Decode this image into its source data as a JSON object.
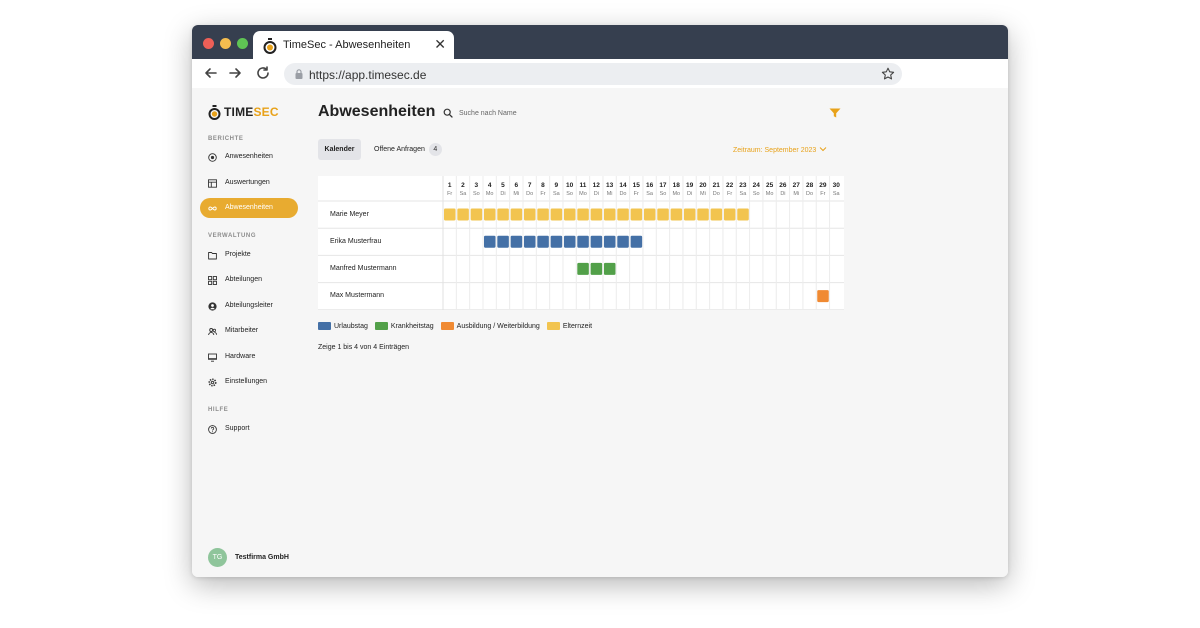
{
  "browser": {
    "tab_title": "TimeSec - Abwesenheiten",
    "url": "https://app.timesec.de",
    "close_symbol": "✕"
  },
  "logo": {
    "part1": "TIME",
    "part2": "SEC"
  },
  "sidebar": {
    "section_berichte": "BERICHTE",
    "section_verwaltung": "VERWALTUNG",
    "section_hilfe": "HILFE",
    "items": [
      {
        "label": "Anwesenheiten",
        "icon": "radio-icon"
      },
      {
        "label": "Auswertungen",
        "icon": "table-icon"
      },
      {
        "label": "Abwesenheiten",
        "icon": "infinity-icon",
        "active": true
      },
      {
        "label": "Projekte",
        "icon": "folder-icon"
      },
      {
        "label": "Abteilungen",
        "icon": "grid-icon"
      },
      {
        "label": "Abteilungsleiter",
        "icon": "user-circle-icon"
      },
      {
        "label": "Mitarbeiter",
        "icon": "users-icon"
      },
      {
        "label": "Hardware",
        "icon": "monitor-icon"
      },
      {
        "label": "Einstellungen",
        "icon": "gear-icon"
      },
      {
        "label": "Support",
        "icon": "help-icon"
      }
    ]
  },
  "company": {
    "initials": "TG",
    "name": "Testfirma GmbH"
  },
  "main": {
    "title": "Abwesenheiten",
    "search_placeholder": "Suche nach Name",
    "tab_kalender": "Kalender",
    "tab_anfragen": "Offene Anfragen",
    "anfragen_count": "4",
    "zeitraum": "Zeitraum: September 2023"
  },
  "calendar": {
    "days": [
      {
        "n": "1",
        "d": "Fr"
      },
      {
        "n": "2",
        "d": "Sa"
      },
      {
        "n": "3",
        "d": "So"
      },
      {
        "n": "4",
        "d": "Mo"
      },
      {
        "n": "5",
        "d": "Di"
      },
      {
        "n": "6",
        "d": "Mi"
      },
      {
        "n": "7",
        "d": "Do"
      },
      {
        "n": "8",
        "d": "Fr"
      },
      {
        "n": "9",
        "d": "Sa"
      },
      {
        "n": "10",
        "d": "So"
      },
      {
        "n": "11",
        "d": "Mo"
      },
      {
        "n": "12",
        "d": "Di"
      },
      {
        "n": "13",
        "d": "Mi"
      },
      {
        "n": "14",
        "d": "Do"
      },
      {
        "n": "15",
        "d": "Fr"
      },
      {
        "n": "16",
        "d": "Sa"
      },
      {
        "n": "17",
        "d": "So"
      },
      {
        "n": "18",
        "d": "Mo"
      },
      {
        "n": "19",
        "d": "Di"
      },
      {
        "n": "20",
        "d": "Mi"
      },
      {
        "n": "21",
        "d": "Do"
      },
      {
        "n": "22",
        "d": "Fr"
      },
      {
        "n": "23",
        "d": "Sa"
      },
      {
        "n": "24",
        "d": "So"
      },
      {
        "n": "25",
        "d": "Mo"
      },
      {
        "n": "26",
        "d": "Di"
      },
      {
        "n": "27",
        "d": "Mi"
      },
      {
        "n": "28",
        "d": "Do"
      },
      {
        "n": "29",
        "d": "Fr"
      },
      {
        "n": "30",
        "d": "Sa"
      }
    ],
    "rows": [
      {
        "name": "Marie Meyer",
        "type": "elternzeit",
        "from": 1,
        "to": 23
      },
      {
        "name": "Erika Musterfrau",
        "type": "urlaub",
        "from": 4,
        "to": 15
      },
      {
        "name": "Manfred Mustermann",
        "type": "krank",
        "from": 11,
        "to": 13
      },
      {
        "name": "Max Mustermann",
        "type": "ausbildung",
        "from": 29,
        "to": 29
      }
    ]
  },
  "legend": [
    {
      "key": "urlaub",
      "label": "Urlaubstag",
      "color": "#4470a6"
    },
    {
      "key": "krank",
      "label": "Krankheitstag",
      "color": "#52a049"
    },
    {
      "key": "ausbildung",
      "label": "Ausbildung / Weiterbildung",
      "color": "#f08a33"
    },
    {
      "key": "elternzeit",
      "label": "Elternzeit",
      "color": "#f2c44f"
    }
  ],
  "entries_info": "Zeige 1 bis 4 von 4 Einträgen"
}
